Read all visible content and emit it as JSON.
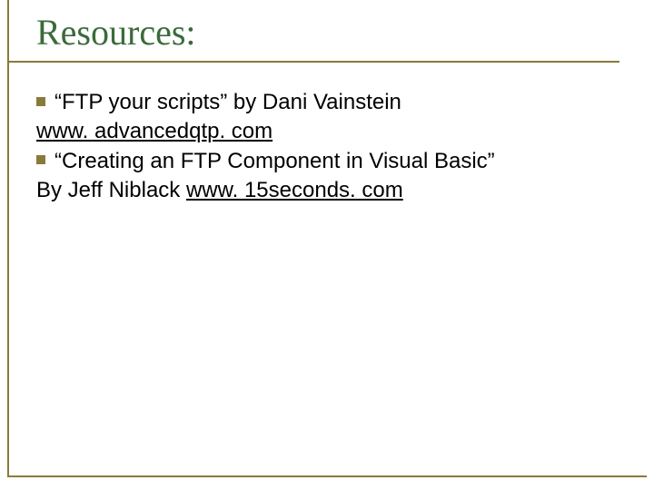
{
  "title": "Resources:",
  "items": [
    {
      "text": "“FTP your scripts” by Dani Vainstein",
      "link": "www. advancedqtp. com",
      "continuation": ""
    },
    {
      "text": "“Creating an FTP Component in Visual Basic”",
      "continuation": "By Jeff Niblack ",
      "link": "www. 15seconds. com"
    }
  ]
}
